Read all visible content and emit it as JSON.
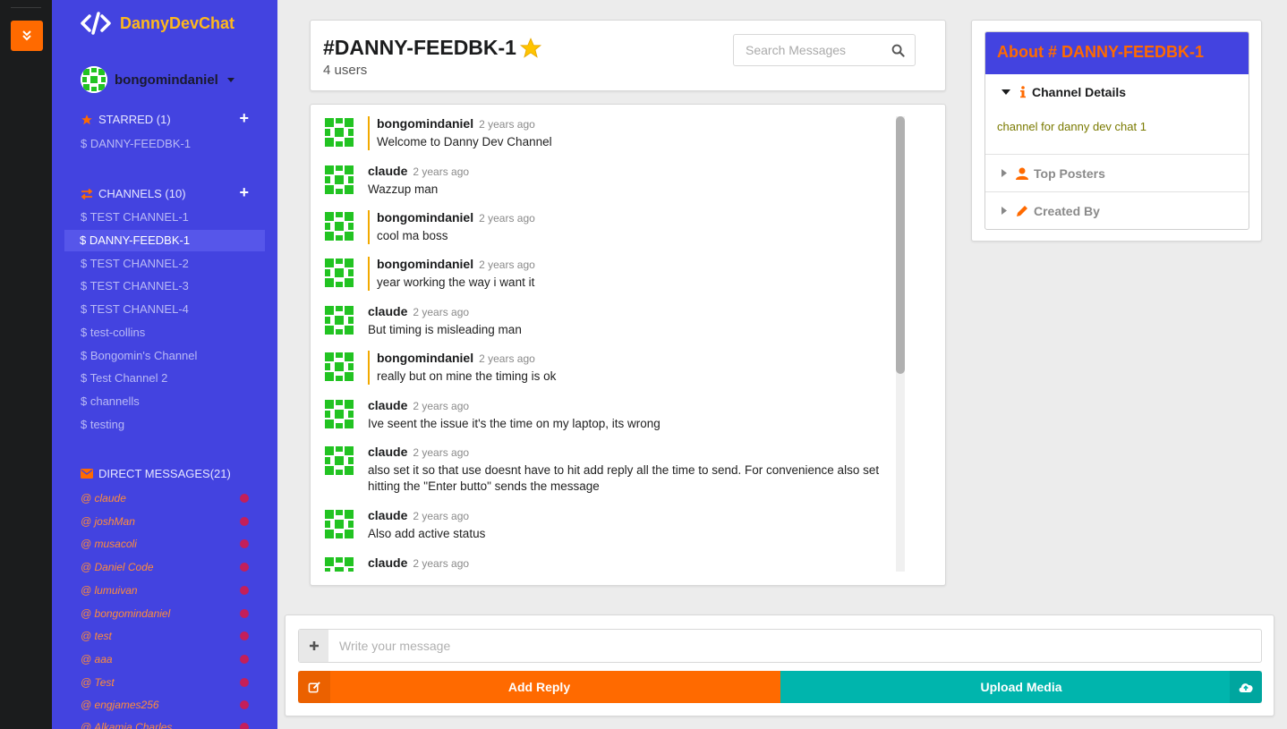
{
  "app": {
    "name": "DannyDevChat",
    "logo_icon": "code-icon"
  },
  "colors": {
    "sidebar": "#4343e0",
    "accent": "#ff6a00",
    "brand": "#ffb81c",
    "teal": "#00b5ad",
    "unread_dot": "#c41f5a"
  },
  "user": {
    "name": "bongomindaniel"
  },
  "sidebar": {
    "starred": {
      "label": "STARRED (1)",
      "items": [
        "$ DANNY-FEEDBK-1"
      ]
    },
    "channels": {
      "label": "CHANNELS (10)",
      "items": [
        "$ TEST CHANNEL-1",
        "$ DANNY-FEEDBK-1",
        "$ TEST CHANNEL-2",
        "$ TEST CHANNEL-3",
        "$ TEST CHANNEL-4",
        "$ test-collins",
        "$ Bongomin's Channel",
        "$ Test Channel 2",
        "$ channells",
        "$ testing"
      ],
      "active_index": 1
    },
    "direct_messages": {
      "label": "DIRECT MESSAGES(21)",
      "items": [
        "@ claude",
        "@ joshMan",
        "@ musacoli",
        "@ Daniel Code",
        "@ lumuivan",
        "@ bongomindaniel",
        "@ test",
        "@ aaa",
        "@ Test",
        "@ engjames256",
        "@ Alkamia Charles"
      ]
    }
  },
  "channel": {
    "title": "#DANNY-FEEDBK-1",
    "users": "4 users",
    "starred": true
  },
  "search": {
    "placeholder": "Search Messages"
  },
  "messages": [
    {
      "author": "bongomindaniel",
      "time": "2 years ago",
      "text": "Welcome to Danny Dev Channel",
      "self": true
    },
    {
      "author": "claude",
      "time": "2 years ago",
      "text": "Wazzup man",
      "self": false
    },
    {
      "author": "bongomindaniel",
      "time": "2 years ago",
      "text": "cool ma boss",
      "self": true
    },
    {
      "author": "bongomindaniel",
      "time": "2 years ago",
      "text": "year working the way i want it",
      "self": true
    },
    {
      "author": "claude",
      "time": "2 years ago",
      "text": "But timing is misleading man",
      "self": false
    },
    {
      "author": "bongomindaniel",
      "time": "2 years ago",
      "text": "really but on mine the timing is ok",
      "self": true
    },
    {
      "author": "claude",
      "time": "2 years ago",
      "text": "Ive seent the issue it's the time on my laptop, its wrong",
      "self": false
    },
    {
      "author": "claude",
      "time": "2 years ago",
      "text": "also set it so that use doesnt have to hit add reply all the time to send. For convenience also set hitting the \"Enter butto\" sends the message",
      "self": false
    },
    {
      "author": "claude",
      "time": "2 years ago",
      "text": "Also add active status",
      "self": false
    },
    {
      "author": "claude",
      "time": "2 years ago",
      "text": "",
      "self": false
    }
  ],
  "about": {
    "title": "About # DANNY-FEEDBK-1",
    "details_label": "Channel Details",
    "description": "channel for danny dev chat 1",
    "top_posters_label": "Top Posters",
    "created_by_label": "Created By"
  },
  "composer": {
    "placeholder": "Write your message",
    "reply_label": "Add Reply",
    "upload_label": "Upload Media"
  }
}
